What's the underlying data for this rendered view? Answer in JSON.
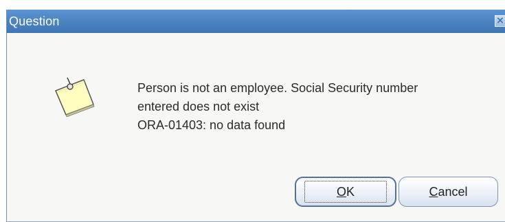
{
  "dialog": {
    "title": "Question",
    "close_symbol": "×",
    "icon": "note-icon",
    "message_lines": [
      "Person is not an employee.  Social Security number",
      "entered does not exist",
      "ORA-01403: no data found"
    ],
    "buttons": {
      "ok": {
        "mnemonic": "O",
        "rest": "K"
      },
      "cancel": {
        "mnemonic": "C",
        "rest": "ancel"
      }
    }
  },
  "colors": {
    "titlebar": "#4a82c0",
    "background": "#f7f7f5",
    "note": "#fffdc0"
  }
}
